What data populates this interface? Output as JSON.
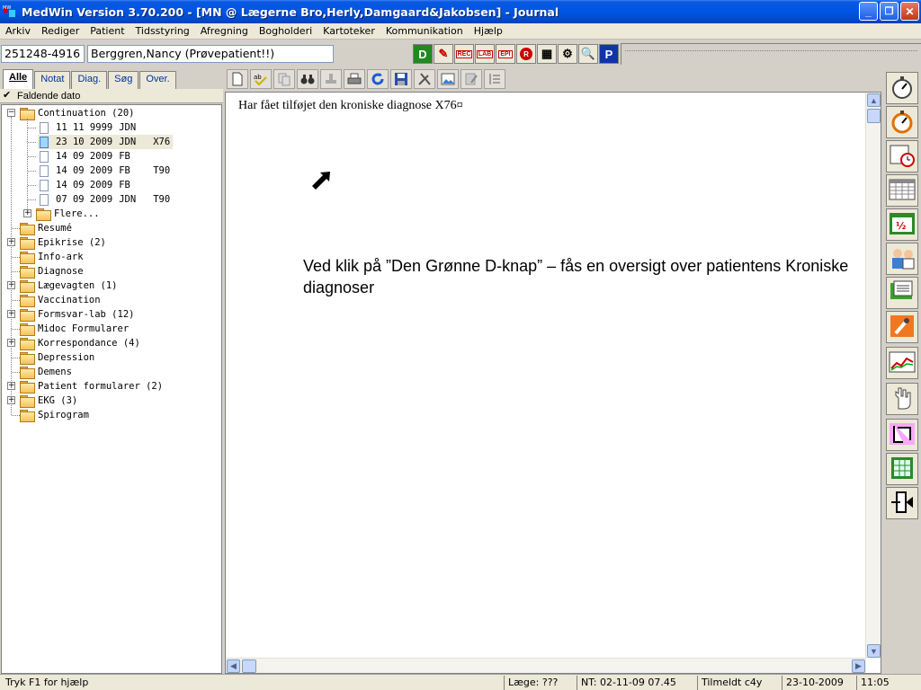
{
  "window": {
    "title": "MedWin Version 3.70.200 - [MN @ Lægerne Bro,Herly,Damgaard&Jakobsen] - Journal",
    "minimize": "_",
    "restore": "❐",
    "close": "✕"
  },
  "menu": [
    "Arkiv",
    "Rediger",
    "Patient",
    "Tidsstyring",
    "Afregning",
    "Bogholderi",
    "Kartoteker",
    "Kommunikation",
    "Hjælp"
  ],
  "patient": {
    "cpr": "251248-4916",
    "name": "Berggren,Nancy (Prøvepatient!!)"
  },
  "quick_buttons": [
    {
      "label": "D",
      "icon": "diagnosis-d-icon",
      "color": "#1f8a1f"
    },
    {
      "label": "✎",
      "icon": "pen-icon",
      "color": "#cc0000"
    },
    {
      "label": "REC",
      "icon": "rec-icon",
      "color": "#cc0000"
    },
    {
      "label": "LAB",
      "icon": "lab-icon",
      "color": "#cc0000"
    },
    {
      "label": "EPI",
      "icon": "epi-icon",
      "color": "#cc0000"
    },
    {
      "label": "R",
      "icon": "r-icon",
      "color": "#cc0000"
    },
    {
      "label": "▦",
      "icon": "fmk-icon",
      "color": "#000000"
    },
    {
      "label": "⚙",
      "icon": "gear-icon",
      "color": "#000000"
    },
    {
      "label": "🔍",
      "icon": "search-icon",
      "color": "#000000"
    },
    {
      "label": "P",
      "icon": "p-icon",
      "color": "#ffffff"
    }
  ],
  "left_tabs": [
    "Alle",
    "Notat",
    "Diag.",
    "Søg",
    "Over."
  ],
  "sort_label": "Faldende dato",
  "tree": {
    "root": "Continuation (20)",
    "entries": [
      {
        "date": "11 11 9999",
        "user": "JDN",
        "code": ""
      },
      {
        "date": "23 10 2009",
        "user": "JDN",
        "code": "X76"
      },
      {
        "date": "14 09 2009",
        "user": "FB",
        "code": ""
      },
      {
        "date": "14 09 2009",
        "user": "FB",
        "code": "T90"
      },
      {
        "date": "14 09 2009",
        "user": "FB",
        "code": ""
      },
      {
        "date": "07 09 2009",
        "user": "JDN",
        "code": "T90"
      }
    ],
    "more": "Flere...",
    "folders": [
      {
        "label": "Resumé",
        "expandable": false
      },
      {
        "label": "Epikrise (2)",
        "expandable": true
      },
      {
        "label": "Info-ark",
        "expandable": false
      },
      {
        "label": "Diagnose",
        "expandable": false
      },
      {
        "label": "Lægevagten (1)",
        "expandable": true
      },
      {
        "label": "Vaccination",
        "expandable": false
      },
      {
        "label": "Formsvar-lab (12)",
        "expandable": true
      },
      {
        "label": "Midoc Formularer",
        "expandable": false
      },
      {
        "label": "Korrespondance (4)",
        "expandable": true
      },
      {
        "label": "Depression",
        "expandable": false
      },
      {
        "label": "Demens",
        "expandable": false
      },
      {
        "label": "Patient formularer (2)",
        "expandable": true
      },
      {
        "label": "EKG (3)",
        "expandable": true
      },
      {
        "label": "Spirogram",
        "expandable": false
      }
    ]
  },
  "document": {
    "text": "Har fået tilføjet den kroniske diagnose X76¤",
    "annotation": "Ved klik på ”Den Grønne D-knap” – fås en oversigt over patientens Kroniske diagnoser"
  },
  "right_buttons": [
    "stopwatch-icon",
    "stopwatch-orange-icon",
    "calendar-clock-icon",
    "calendar-icon",
    "calendar-half-icon",
    "doctor-nurse-icon",
    "records-icon",
    "medicine-icon",
    "graph-icon",
    "hand-icon",
    "form-icon",
    "spreadsheet-icon",
    "exit-door-icon"
  ],
  "status": {
    "help": "Tryk F1 for hjælp",
    "doctor": "Læge: ???",
    "nt": "NT: 02-11-09 07.45",
    "registered": "Tilmeldt c4y",
    "date": "23-10-2009",
    "time": "11:05"
  }
}
